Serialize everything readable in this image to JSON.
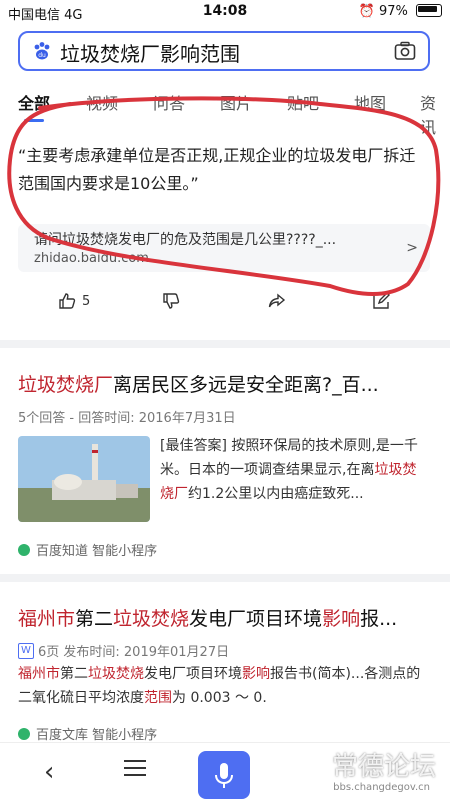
{
  "status_bar": {
    "carrier": "中国电信  4G",
    "time": "14:08",
    "battery": "97%"
  },
  "search": {
    "query": "垃圾焚烧厂影响范围"
  },
  "tabs": [
    "全部",
    "视频",
    "问答",
    "图片",
    "贴吧",
    "地图",
    "资讯"
  ],
  "answer_card": {
    "quote": "“主要考虑承建单位是否正规,正规企业的垃圾发电厂拆迁范围国内要求是10公里。”",
    "related_title": "请问垃圾焚烧发电厂的危及范围是几公里????_...",
    "related_url": "zhidao.baidu.com",
    "like_count": "5"
  },
  "result1": {
    "title_red": "垃圾焚烧厂",
    "title_rest": "离居民区多远是安全距离?_百...",
    "meta": "5个回答 - 回答时间:  2016年7月31日",
    "snippet_a": "[最佳答案] 按照环保局的技术原则,是一千米。日本的一项调查结果显示,在离",
    "snippet_red": "垃圾焚烧厂",
    "snippet_b": "约1.2公里以内由癌症致死...",
    "source": "百度知道  智能小程序"
  },
  "result2": {
    "t1": "福州市",
    "t2": "第二",
    "t3": "垃圾焚烧",
    "t4": "发电厂项目环境",
    "t5": "影响",
    "t6": "报...",
    "doc_badge": "W",
    "meta": "6页   发布时间: 2019年01月27日",
    "s1": "福州市",
    "s2": "第二",
    "s3": "垃圾焚烧",
    "s4": "发电厂项目环境",
    "s5": "影响",
    "s6": "报告书(简本)...各测点的二氧化硫日平均浓度",
    "s7": "范围",
    "s8": "为 0.003 ～ 0.",
    "source": "百度文库  智能小程序"
  },
  "watermark": {
    "text": "常德论坛",
    "url": "bbs.changdegov.cn"
  },
  "colors": {
    "accent": "#4e6ef2",
    "red_hl": "#c0252f",
    "annotation": "#d9343c"
  }
}
